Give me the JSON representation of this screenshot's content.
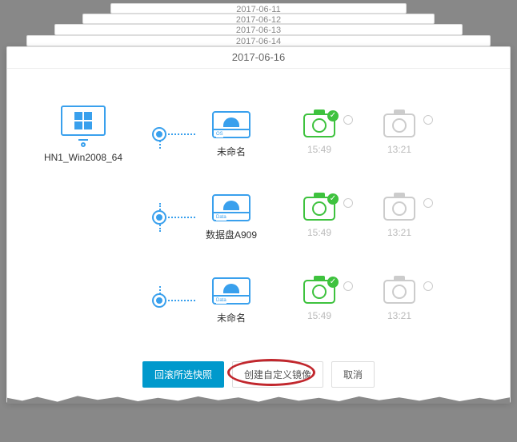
{
  "stacked_dates": [
    "2017-06-11",
    "2017-06-12",
    "2017-06-13",
    "2017-06-14"
  ],
  "main_date": "2017-06-16",
  "instance": {
    "name": "HN1_Win2008_64"
  },
  "disks": [
    {
      "tag": "OS",
      "label": "未命名",
      "snap1_time": "15:49",
      "snap2_time": "13:21"
    },
    {
      "tag": "Data",
      "label": "数据盘A909",
      "snap1_time": "15:49",
      "snap2_time": "13:21"
    },
    {
      "tag": "Data",
      "label": "未命名",
      "snap1_time": "15:49",
      "snap2_time": "13:21"
    }
  ],
  "buttons": {
    "rollback": "回滚所选快照",
    "create_image": "创建自定义镜像",
    "cancel": "取消"
  }
}
